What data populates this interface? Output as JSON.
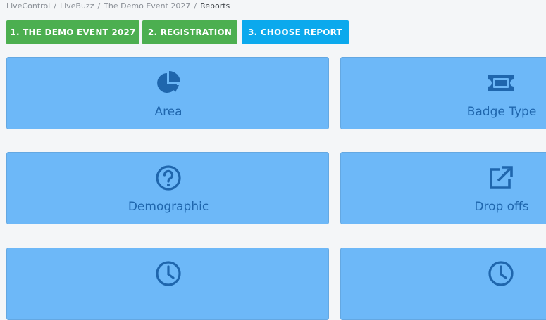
{
  "breadcrumb": {
    "items": [
      "LiveControl",
      "LiveBuzz",
      "The Demo Event 2027"
    ],
    "current": "Reports"
  },
  "steps": [
    {
      "label": "1. THE DEMO EVENT 2027",
      "state": "done"
    },
    {
      "label": "2. REGISTRATION",
      "state": "done"
    },
    {
      "label": "3. CHOOSE REPORT",
      "state": "active"
    }
  ],
  "colors": {
    "step_done": "#4caf50",
    "step_active": "#0ba9ed",
    "card_bg": "#6db8f8",
    "card_text": "#1f66ad"
  },
  "reports": [
    {
      "label": "Area",
      "icon": "pie-chart-icon"
    },
    {
      "label": "Badge Type",
      "icon": "ticket-icon"
    },
    {
      "label": "Demographic",
      "icon": "question-circle-icon"
    },
    {
      "label": "Drop offs",
      "icon": "external-link-icon"
    },
    {
      "label": "",
      "icon": "clock-icon"
    },
    {
      "label": "",
      "icon": "clock-icon"
    }
  ]
}
